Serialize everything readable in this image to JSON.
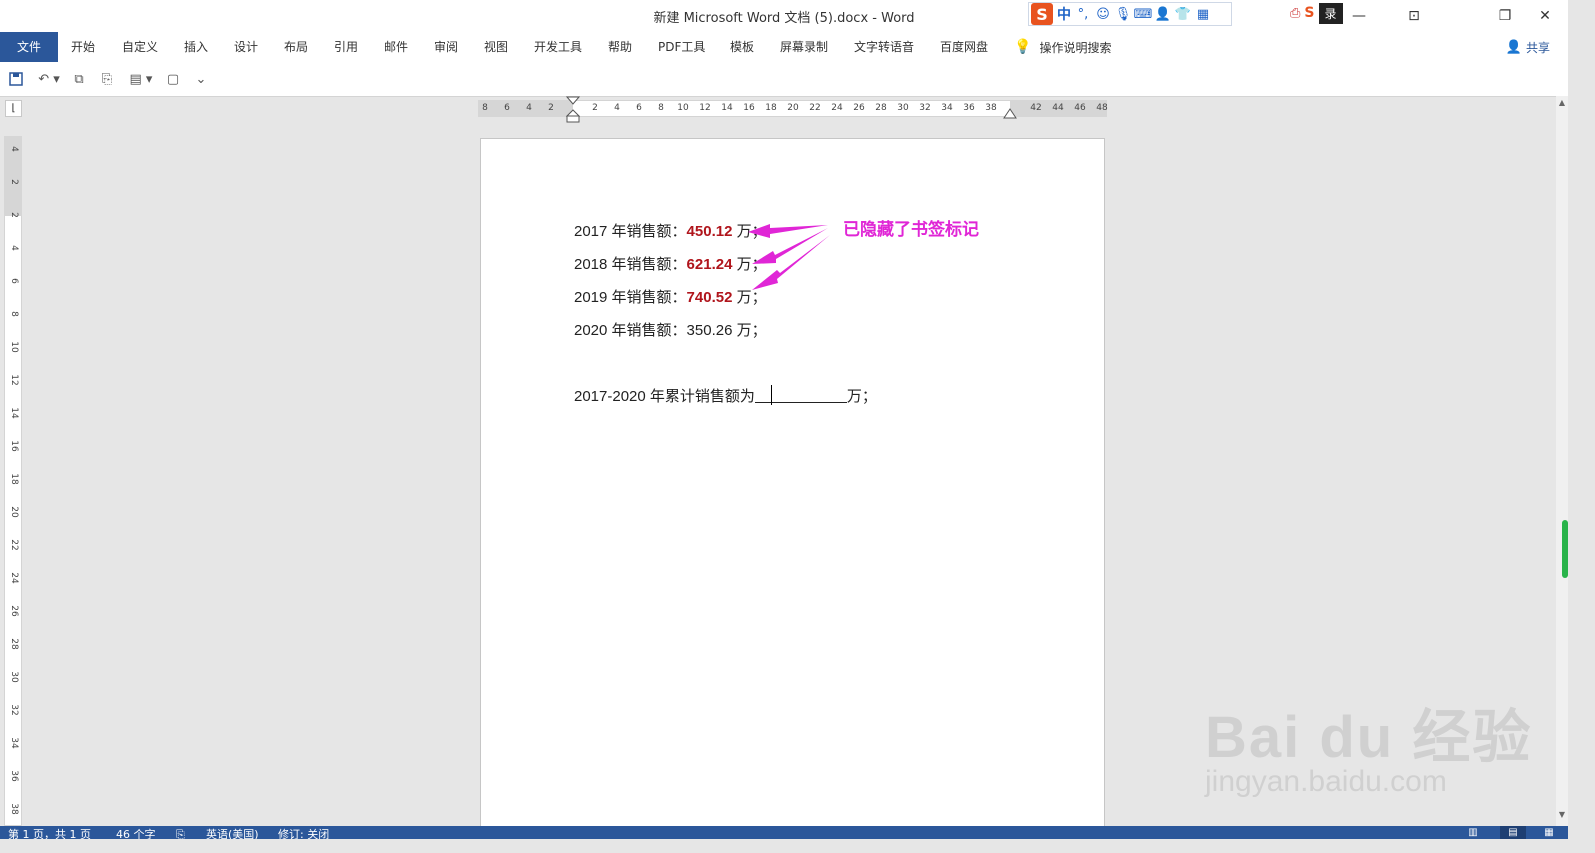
{
  "window": {
    "title": "新建 Microsoft Word 文档 (5).docx  -  Word",
    "login_label": "录",
    "minimize": "—",
    "restore_icon": "❐",
    "close": "✕"
  },
  "ime": {
    "logo": "S",
    "mode": "中",
    "punct": "°,"
  },
  "ribbon": {
    "file": "文件",
    "tabs": [
      "开始",
      "自定义",
      "插入",
      "设计",
      "布局",
      "引用",
      "邮件",
      "审阅",
      "视图",
      "开发工具",
      "帮助",
      "PDF工具",
      "模板",
      "屏幕录制",
      "文字转语音",
      "百度网盘"
    ],
    "tell_me": "操作说明搜索",
    "share": "共享"
  },
  "ruler": {
    "h_ticks": [
      "8",
      "6",
      "4",
      "2",
      "2",
      "4",
      "6",
      "8",
      "10",
      "12",
      "14",
      "16",
      "18",
      "20",
      "22",
      "24",
      "26",
      "28",
      "30",
      "32",
      "34",
      "36",
      "38",
      "42",
      "44",
      "46",
      "48"
    ],
    "v_ticks": [
      "4",
      "2",
      "2",
      "4",
      "6",
      "8",
      "10",
      "12",
      "14",
      "16",
      "18",
      "20",
      "22",
      "24",
      "26",
      "28",
      "30",
      "32",
      "34",
      "36",
      "38"
    ]
  },
  "document": {
    "lines": [
      {
        "prefix": "2017 年销售额：",
        "value": "450.12",
        "suffix": " 万；",
        "bookmarked": true
      },
      {
        "prefix": "2018 年销售额：",
        "value": "621.24",
        "suffix": " 万；",
        "bookmarked": true
      },
      {
        "prefix": "2019 年销售额：",
        "value": "740.52",
        "suffix": " 万；",
        "bookmarked": true
      },
      {
        "prefix": "2020 年销售额：",
        "value": "350.26",
        "suffix": " 万；",
        "bookmarked": false
      }
    ],
    "total_prefix": "2017-2020 年累计销售额为",
    "total_suffix": "万；"
  },
  "annotation": {
    "text": "已隐藏了书签标记",
    "color": "#e026d6"
  },
  "statusbar": {
    "page": "第 1 页，共 1 页",
    "words": "46 个字",
    "language": "英语(美国)",
    "track": "修订: 关闭"
  },
  "watermark": {
    "main": "Bai du 经验",
    "sub": "jingyan.baidu.com"
  },
  "colors": {
    "accent": "#2b579a",
    "value_red": "#b0151c",
    "annotation": "#e026d6"
  }
}
